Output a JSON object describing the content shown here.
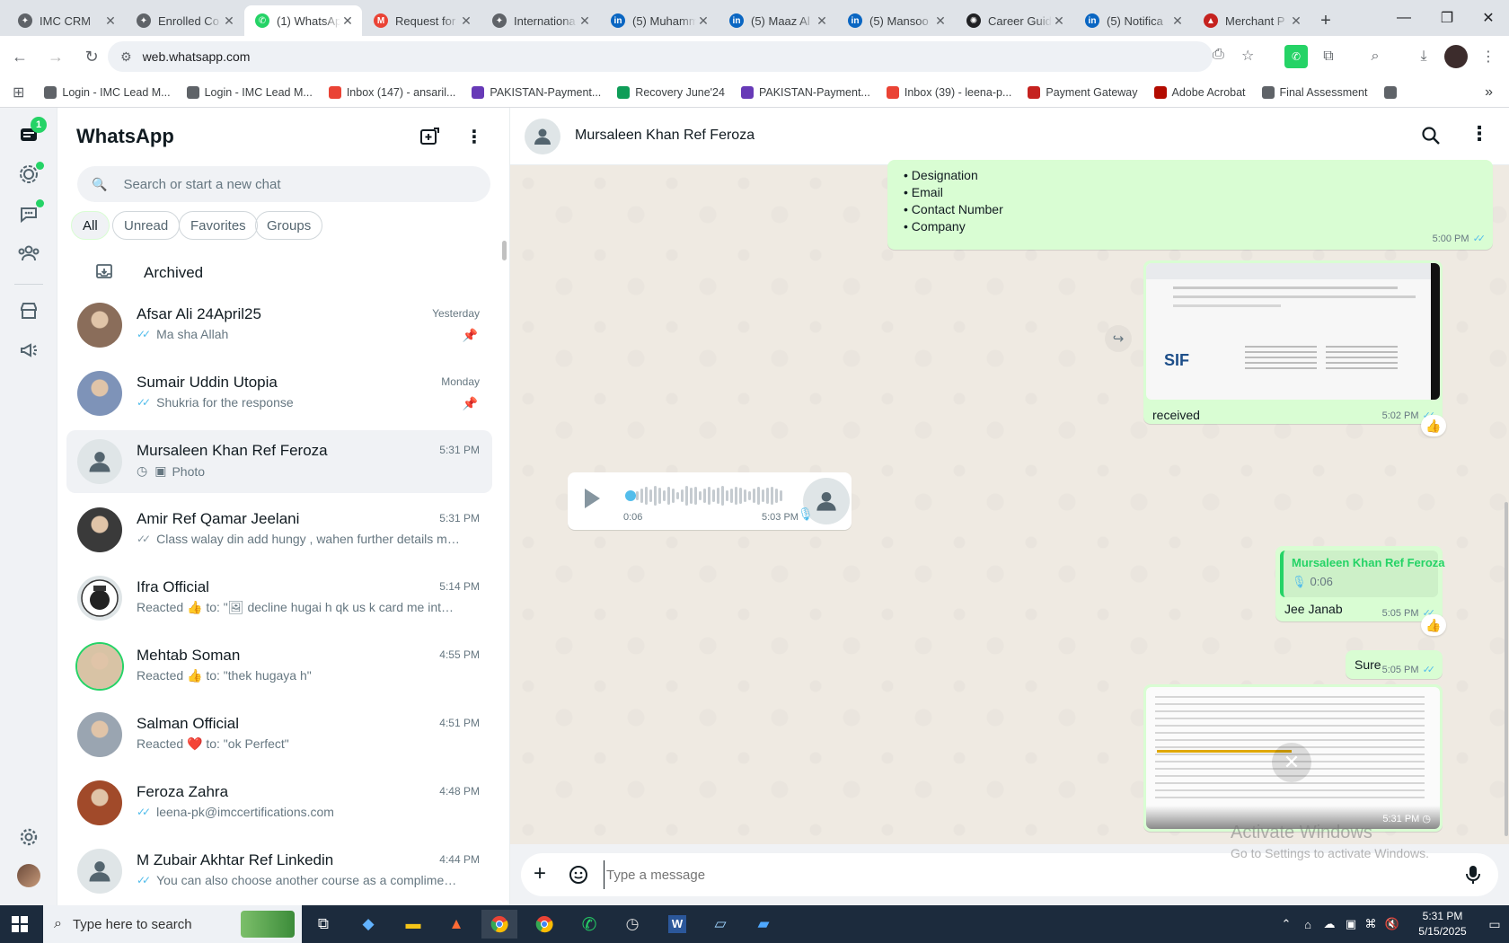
{
  "browser": {
    "tabs": [
      {
        "title": "IMC CRM",
        "icon": "crm-icon",
        "color": "#5f6368"
      },
      {
        "title": "Enrolled Co",
        "icon": "crm-icon",
        "color": "#5f6368"
      },
      {
        "title": "(1) WhatsApp",
        "icon": "whatsapp-icon",
        "color": "#25d366",
        "active": true
      },
      {
        "title": "Request for",
        "icon": "gmail-icon",
        "color": "#ea4335"
      },
      {
        "title": "Internationa",
        "icon": "crm-icon",
        "color": "#5f6368"
      },
      {
        "title": "(5) Muhamm",
        "icon": "linkedin-icon",
        "color": "#0a66c2"
      },
      {
        "title": "(5) Maaz Al",
        "icon": "linkedin-icon",
        "color": "#0a66c2"
      },
      {
        "title": "(5) Mansoo",
        "icon": "linkedin-icon",
        "color": "#0a66c2"
      },
      {
        "title": "Career Guid",
        "icon": "openai-icon",
        "color": "#202124"
      },
      {
        "title": "(5) Notifica",
        "icon": "linkedin-icon",
        "color": "#0a66c2"
      },
      {
        "title": "Merchant P",
        "icon": "merchant-icon",
        "color": "#c5221f"
      }
    ],
    "url": "web.whatsapp.com",
    "bookmarks": [
      {
        "label": "Login - IMC Lead M...",
        "color": "#5f6368"
      },
      {
        "label": "Login - IMC Lead M...",
        "color": "#5f6368"
      },
      {
        "label": "Inbox (147) - ansaril...",
        "color": "#ea4335"
      },
      {
        "label": "PAKISTAN-Payment...",
        "color": "#673ab7"
      },
      {
        "label": "Recovery June'24",
        "color": "#0f9d58"
      },
      {
        "label": "PAKISTAN-Payment...",
        "color": "#673ab7"
      },
      {
        "label": "Inbox (39) - leena-p...",
        "color": "#ea4335"
      },
      {
        "label": "Payment Gateway",
        "color": "#c5221f"
      },
      {
        "label": "Adobe Acrobat",
        "color": "#b30b00"
      },
      {
        "label": "Final Assessment",
        "color": "#5f6368"
      }
    ]
  },
  "whatsapp": {
    "title": "WhatsApp",
    "rail_badge": "1",
    "search_placeholder": "Search or start a new chat",
    "filters": [
      "All",
      "Unread",
      "Favorites",
      "Groups"
    ],
    "archived_label": "Archived",
    "chats": [
      {
        "name": "Afsar Ali 24April25",
        "time": "Yesterday",
        "preview": "Ma sha Allah",
        "ticks": "blue",
        "pinned": true,
        "avatar": "photo"
      },
      {
        "name": "Sumair Uddin Utopia",
        "time": "Monday",
        "preview": "Shukria for the response",
        "ticks": "blue",
        "pinned": true,
        "avatar": "photo"
      },
      {
        "name": "Mursaleen Khan Ref Feroza",
        "time": "5:31 PM",
        "preview": "Photo",
        "ticks": "clock",
        "pinned": false,
        "avatar": "default",
        "selected": true
      },
      {
        "name": "Amir Ref Qamar Jeelani",
        "time": "5:31 PM",
        "preview": "Class walay din add hungy , wahen further details milen...",
        "ticks": "grey",
        "pinned": false,
        "avatar": "photo"
      },
      {
        "name": "Ifra Official",
        "time": "5:14 PM",
        "preview": "Reacted 👍 to: \"🖼 decline hugai h qk us k card me intern...",
        "ticks": "none",
        "pinned": false,
        "avatar": "logo"
      },
      {
        "name": "Mehtab Soman",
        "time": "4:55 PM",
        "preview": "Reacted 👍 to: \"thek hugaya h\"",
        "ticks": "none",
        "pinned": false,
        "avatar": "photo"
      },
      {
        "name": "Salman Official",
        "time": "4:51 PM",
        "preview": "Reacted ❤️ to: \"ok Perfect\"",
        "ticks": "none",
        "pinned": false,
        "avatar": "photo"
      },
      {
        "name": "Feroza Zahra",
        "time": "4:48 PM",
        "preview": "leena-pk@imccertifications.com",
        "ticks": "blue",
        "pinned": false,
        "avatar": "photo"
      },
      {
        "name": "M Zubair Akhtar Ref Linkedin",
        "time": "4:44 PM",
        "preview": "You can also choose another course as a complimentar...",
        "ticks": "blue",
        "pinned": false,
        "avatar": "default"
      }
    ],
    "conversation": {
      "contact_name": "Mursaleen Khan Ref Feroza",
      "list_items": [
        "Designation",
        "Email",
        "Contact Number",
        "Company"
      ],
      "list_time": "5:00 PM",
      "image_caption": "received",
      "image_time": "5:02 PM",
      "image_text_sif": "SIF",
      "voice_duration": "0:06",
      "voice_time": "5:03 PM",
      "reply_quote_name": "Mursaleen Khan Ref Feroza",
      "reply_quote_duration": "0:06",
      "reply_text": "Jee Janab",
      "reply_time": "5:05 PM",
      "sure_text": "Sure",
      "sure_time": "5:05 PM",
      "last_image_time": "5:31 PM",
      "reaction_emoji": "👍",
      "composer_placeholder": "Type a message"
    },
    "watermark_title": "Activate Windows",
    "watermark_sub": "Go to Settings to activate Windows."
  },
  "taskbar": {
    "search_placeholder": "Type here to search",
    "time": "5:31 PM",
    "date": "5/15/2025"
  }
}
